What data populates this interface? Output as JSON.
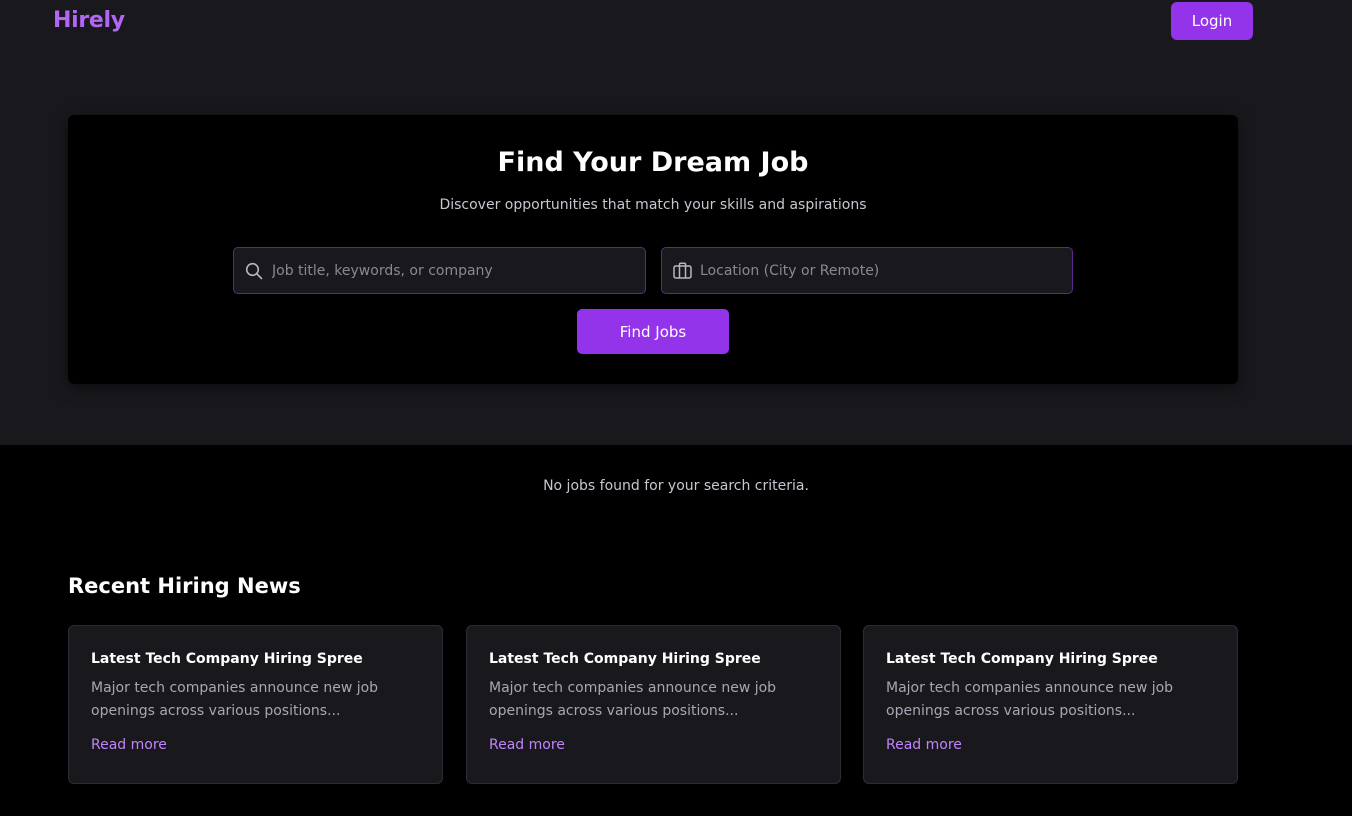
{
  "header": {
    "logo": "Hirely",
    "login_label": "Login"
  },
  "hero": {
    "title": "Find Your Dream Job",
    "subtitle": "Discover opportunities that match your skills and aspirations",
    "search_placeholder": "Job title, keywords, or company",
    "location_placeholder": "Location (City or Remote)",
    "search_value": "",
    "location_value": "",
    "find_label": "Find Jobs"
  },
  "results": {
    "empty_message": "No jobs found for your search criteria."
  },
  "news": {
    "heading": "Recent Hiring News",
    "cards": [
      {
        "title": "Latest Tech Company Hiring Spree",
        "description": "Major tech companies announce new job openings across various positions...",
        "link": "Read more"
      },
      {
        "title": "Latest Tech Company Hiring Spree",
        "description": "Major tech companies announce new job openings across various positions...",
        "link": "Read more"
      },
      {
        "title": "Latest Tech Company Hiring Spree",
        "description": "Major tech companies announce new job openings across various positions...",
        "link": "Read more"
      }
    ]
  },
  "icons": {
    "search": "search-icon",
    "location": "briefcase-icon"
  },
  "colors": {
    "accent": "#9333ea",
    "logo": "#b266f5",
    "link": "#c084fc",
    "page_bg": "#000000",
    "panel_bg": "#19181d"
  }
}
